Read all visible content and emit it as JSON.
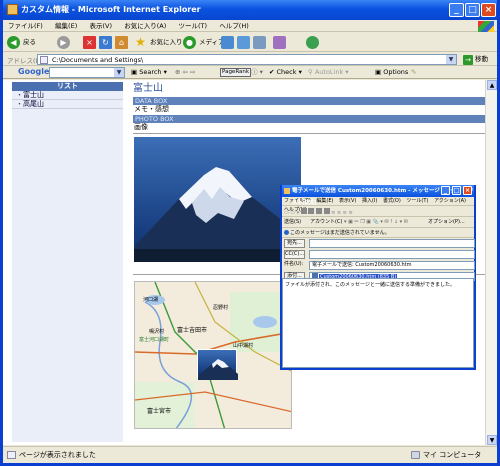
{
  "window": {
    "title": "カスタム情報 - Microsoft Internet Explorer",
    "minimize": "_",
    "maximize": "□",
    "close": "×"
  },
  "menu": [
    "ファイル(F)",
    "編集(E)",
    "表示(V)",
    "お気に入り(A)",
    "ツール(T)",
    "ヘルプ(H)"
  ],
  "toolbar": {
    "back": "戻る",
    "favorites": "お気に入り",
    "media": "メディア"
  },
  "address": {
    "label": "アドレス(D)",
    "value": "C:\\Documents and Settings\\",
    "go": "移動"
  },
  "google_bar": {
    "logo": "Google",
    "search": "Search",
    "pagerank": "PageRank",
    "check": "Check",
    "autolink": "AutoLink",
    "options": "Options"
  },
  "sidebar": {
    "heading": "リスト",
    "items": [
      "富士山",
      "高尾山"
    ]
  },
  "main": {
    "title": "富士山",
    "data_box": "DATA BOX",
    "memo": "メモ・感想",
    "photo_box": "PHOTO BOX",
    "image_label": "画像"
  },
  "map_labels": [
    "河口湖",
    "富士吉田市",
    "忍野村",
    "山中湖村",
    "鳴沢村",
    "富士宮市",
    "富士河口湖町"
  ],
  "popup": {
    "title": "電子メールで送信 Custom20060630.htm - メッセージ (リッチ テキスト形式)",
    "menu": [
      "ファイル(F)",
      "編集(E)",
      "表示(V)",
      "挿入(I)",
      "書式(O)",
      "ツール(T)",
      "アクション(A)",
      "ヘルプ(H)"
    ],
    "toolbar": {
      "send": "送信(S)",
      "account": "アカウント(C)",
      "options": "オプション(P)..."
    },
    "info": "このメッセージはまだ送信されていません。",
    "to_label": "宛先...",
    "cc_label": "CC(C)...",
    "subject_label": "件名(U):",
    "subject_value": "電子メールで送信: Custom20060630.htm",
    "attach_label": "添付...",
    "attach_value": "Custom20060630.htm (835 B)",
    "body": "ファイルが添付され、このメッセージと一緒に送信する準備ができました。"
  },
  "status": {
    "left": "ページが表示されました",
    "right": "マイ コンピュータ"
  }
}
